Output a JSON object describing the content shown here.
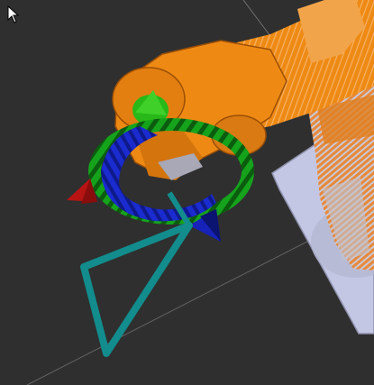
{
  "scene": {
    "background_color": "#2f2f2f",
    "grid_color": "#8c8c8c",
    "robot_color": "#ee8a14",
    "robot_shadow_color": "#b85f06",
    "robot_highlight_color": "#f7b15a",
    "base_color": "#c8cbe6",
    "base_metal_color": "#a9acbf",
    "end_effector_color": "#2bbf19",
    "ring_green": "#15a31c",
    "ring_green_dark": "#0b5c0e",
    "ring_blue": "#1726c8",
    "arrow_red": "#b81414",
    "arrow_blue": "#1622b8",
    "trajectory_color": "#128c8c"
  },
  "icons": {
    "cursor": "mouse-pointer-icon",
    "rotate_ring_x": "rotate-ring-x-icon",
    "rotate_ring_z": "rotate-ring-z-icon",
    "move_arrow_x": "move-arrow-x-icon",
    "move_arrow_y": "move-arrow-y-icon"
  }
}
